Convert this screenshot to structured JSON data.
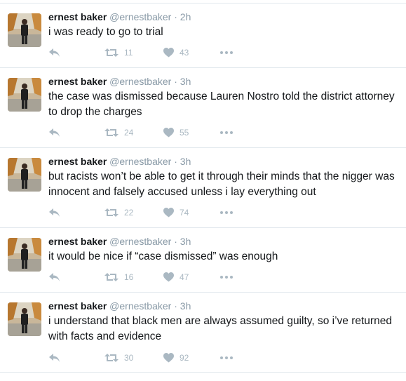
{
  "tweets": [
    {
      "name": "ernest baker",
      "handle": "@ernestbaker",
      "sep": "·",
      "time": "2h",
      "text": "i was ready to go to trial",
      "retweets": "11",
      "likes": "43"
    },
    {
      "name": "ernest baker",
      "handle": "@ernestbaker",
      "sep": "·",
      "time": "3h",
      "text": "the case was dismissed because Lauren Nostro told the district attorney to drop the charges",
      "retweets": "24",
      "likes": "55"
    },
    {
      "name": "ernest baker",
      "handle": "@ernestbaker",
      "sep": "·",
      "time": "3h",
      "text": "but racists won’t be able to get it through their minds that the nigger was innocent and falsely accused unless i lay everything out",
      "retweets": "22",
      "likes": "74"
    },
    {
      "name": "ernest baker",
      "handle": "@ernestbaker",
      "sep": "·",
      "time": "3h",
      "text": "it would be nice if “case dismissed” was enough",
      "retweets": "16",
      "likes": "47"
    },
    {
      "name": "ernest baker",
      "handle": "@ernestbaker",
      "sep": "·",
      "time": "3h",
      "text": "i understand that black men are always assumed guilty, so i’ve returned with facts and evidence",
      "retweets": "30",
      "likes": "92"
    }
  ],
  "icons": {
    "reply": "reply-icon",
    "retweet": "retweet-icon",
    "like": "heart-icon",
    "more": "more-icon"
  },
  "colors": {
    "icon": "#aab8c2",
    "handle": "#8899a6",
    "divider": "#e1e8ed"
  }
}
